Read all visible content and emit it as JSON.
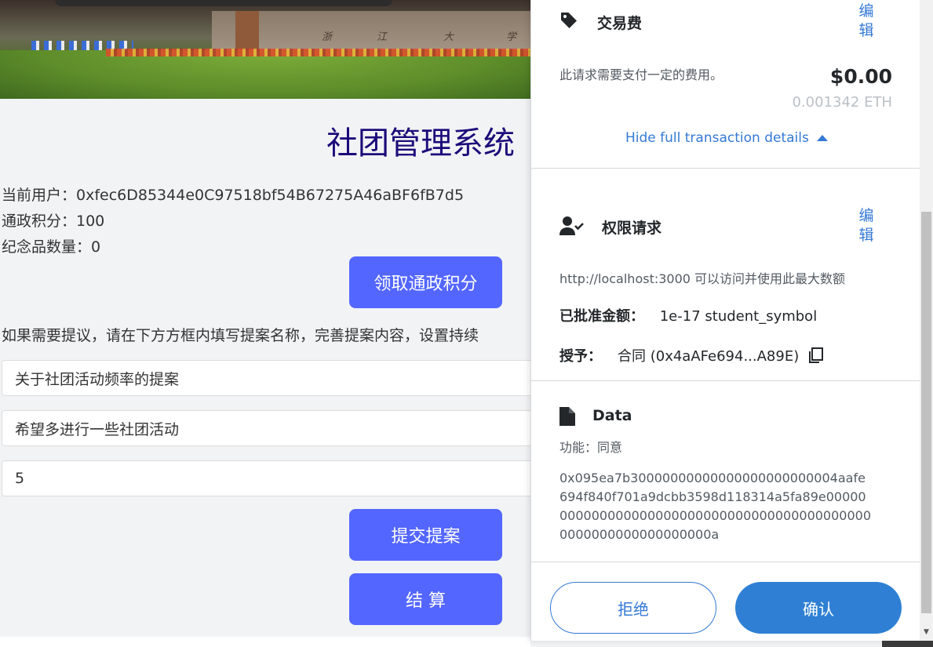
{
  "page": {
    "title": "社团管理系统",
    "user_line": "当前用户：0xfec6D85344e0C97518bf54B67275A46aBF6fB7d5",
    "points_line": "通政积分：100",
    "souvenir_line": "纪念品数量：0",
    "claim_button": "领取通政积分",
    "hint_line": "如果需要提议，请在下方方框内填写提案名称，完善提案内容，设置持续",
    "proposal_name_value": "关于社团活动频率的提案",
    "proposal_content_value": "希望多进行一些社团活动",
    "duration_value": "5",
    "submit_button": "提交提案",
    "settle_button": "结 算"
  },
  "popup": {
    "fee": {
      "title": "交易费",
      "edit_label": "编辑",
      "description": "此请求需要支付一定的费用。",
      "usd": "$0.00",
      "eth": "0.001342 ETH",
      "details_toggle": "Hide full transaction details"
    },
    "permission": {
      "title": "权限请求",
      "edit_label": "编辑",
      "description": "http://localhost:3000 可以访问并使用此最大数额",
      "approved_label": "已批准金额：",
      "approved_value": "1e-17 student_symbol",
      "grant_label": "授予：",
      "grant_value": "合同 (0x4aAFe694...A89E)"
    },
    "data": {
      "title": "Data",
      "function_line": "功能：同意",
      "hex": "0x095ea7b30000000000000000000000004aafe694f840f701a9dcbb3598d118314a5fa89e000000000000000000000000000000000000000000000000000000000000000a"
    },
    "buttons": {
      "reject": "拒绝",
      "confirm": "确认"
    }
  },
  "colors": {
    "primary_button": "#5366ff",
    "title_color": "#1b0b7a",
    "link_blue": "#3479d4",
    "confirm_blue": "#2f80d4"
  },
  "icons": [
    "tag-icon",
    "user-check-icon",
    "file-icon",
    "copy-icon"
  ]
}
